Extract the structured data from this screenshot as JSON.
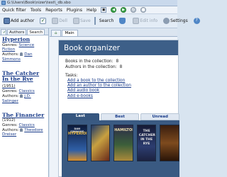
{
  "window": {
    "title": "G:\\Users\\Book\\nizer\\test\\_db.sbo"
  },
  "menu": {
    "quick_filter": "Quick filter",
    "tools": "Tools",
    "reports": "Reports",
    "plugins": "Plugins",
    "help": "Help"
  },
  "toolbar": {
    "add_author": "Add author",
    "edit_dim": "Dell",
    "save": "Save",
    "search": "Search",
    "edit_info": "Edit info",
    "settings": "Settings"
  },
  "left_tabs": {
    "check": "✓",
    "authors": "Authors",
    "search": "Search"
  },
  "books": [
    {
      "title": "Hyperion",
      "year": "",
      "genres_label": "Genres:",
      "genre": "Science Fiction",
      "authors_label": "Authors:",
      "author": "Dan Simmons"
    },
    {
      "title": "The Catcher In the Rye",
      "year": "(1951)",
      "genres_label": "Genres:",
      "genre": "Classics",
      "authors_label": "Authors:",
      "author": "J.D. Salinger"
    },
    {
      "title": "The Financier",
      "year": "(1912)",
      "genres_label": "Genres:",
      "genre": "Classics",
      "authors_label": "Authors:",
      "author": "Theodore Dreiser"
    }
  ],
  "right_tabs": {
    "home": "⌂",
    "main": "Main"
  },
  "page": {
    "banner_title": "Book organizer",
    "stats": [
      {
        "label": "Books in the collection:",
        "value": "8"
      },
      {
        "label": "Authors in the collection:",
        "value": "8"
      }
    ],
    "tasks_label": "Tasks:",
    "tasks": [
      "Add a book to the collection",
      "Add an author to the collection",
      "Add audio book",
      "Add e-books"
    ]
  },
  "categories": [
    "Last",
    "Best",
    "Unread"
  ],
  "covers": [
    {
      "author": "DAN SIMMONS",
      "title": "HYPERION"
    },
    {
      "author": "",
      "title": ""
    },
    {
      "author": "",
      "title": "HAMILTON"
    },
    {
      "author": "",
      "title": "THE CATCHER IN THE RYE"
    },
    {
      "author": "",
      "title": ""
    }
  ],
  "colors": {
    "banner": "#3d5f88",
    "link": "#1a3c8a",
    "cover_strip": "#3a5a82"
  }
}
